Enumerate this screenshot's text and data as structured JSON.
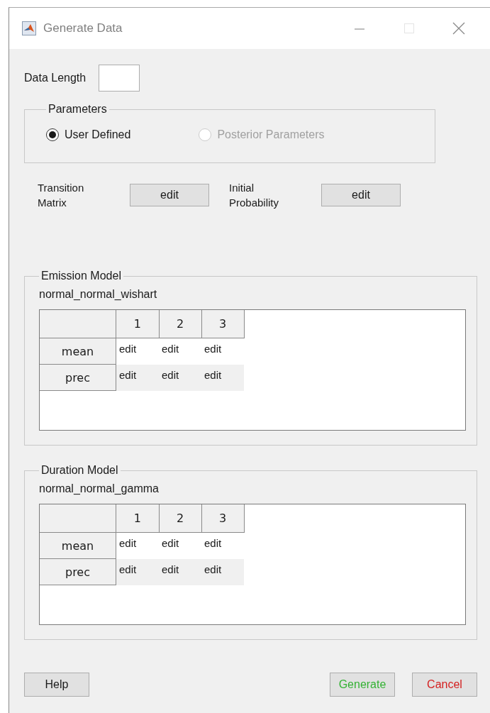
{
  "window": {
    "title": "Generate Data"
  },
  "data_length": {
    "label": "Data Length"
  },
  "parameters": {
    "title": "Parameters",
    "options": [
      {
        "label": "User Defined",
        "selected": true,
        "disabled": false
      },
      {
        "label": "Posterior Parameters",
        "selected": false,
        "disabled": true
      }
    ]
  },
  "editors": [
    {
      "label": "Transition Matrix",
      "button": "edit"
    },
    {
      "label": "Initial Probability",
      "button": "edit"
    }
  ],
  "panels": [
    {
      "title": "Emission Model",
      "model": "normal_normal_wishart",
      "table": {
        "columns": [
          "1",
          "2",
          "3"
        ],
        "rows": [
          {
            "header": "mean",
            "cells": [
              "edit",
              "edit",
              "edit"
            ]
          },
          {
            "header": "prec",
            "cells": [
              "edit",
              "edit",
              "edit"
            ]
          }
        ]
      }
    },
    {
      "title": "Duration Model",
      "model": "normal_normal_gamma",
      "table": {
        "columns": [
          "1",
          "2",
          "3"
        ],
        "rows": [
          {
            "header": "mean",
            "cells": [
              "edit",
              "edit",
              "edit"
            ]
          },
          {
            "header": "prec",
            "cells": [
              "edit",
              "edit",
              "edit"
            ]
          }
        ]
      }
    }
  ],
  "buttons": {
    "left": [
      {
        "label": "Help",
        "color": "#1a1a1a"
      }
    ],
    "right": [
      {
        "label": "Generate",
        "color": "#33b233"
      },
      {
        "label": "Cancel",
        "color": "#d42020"
      }
    ]
  }
}
